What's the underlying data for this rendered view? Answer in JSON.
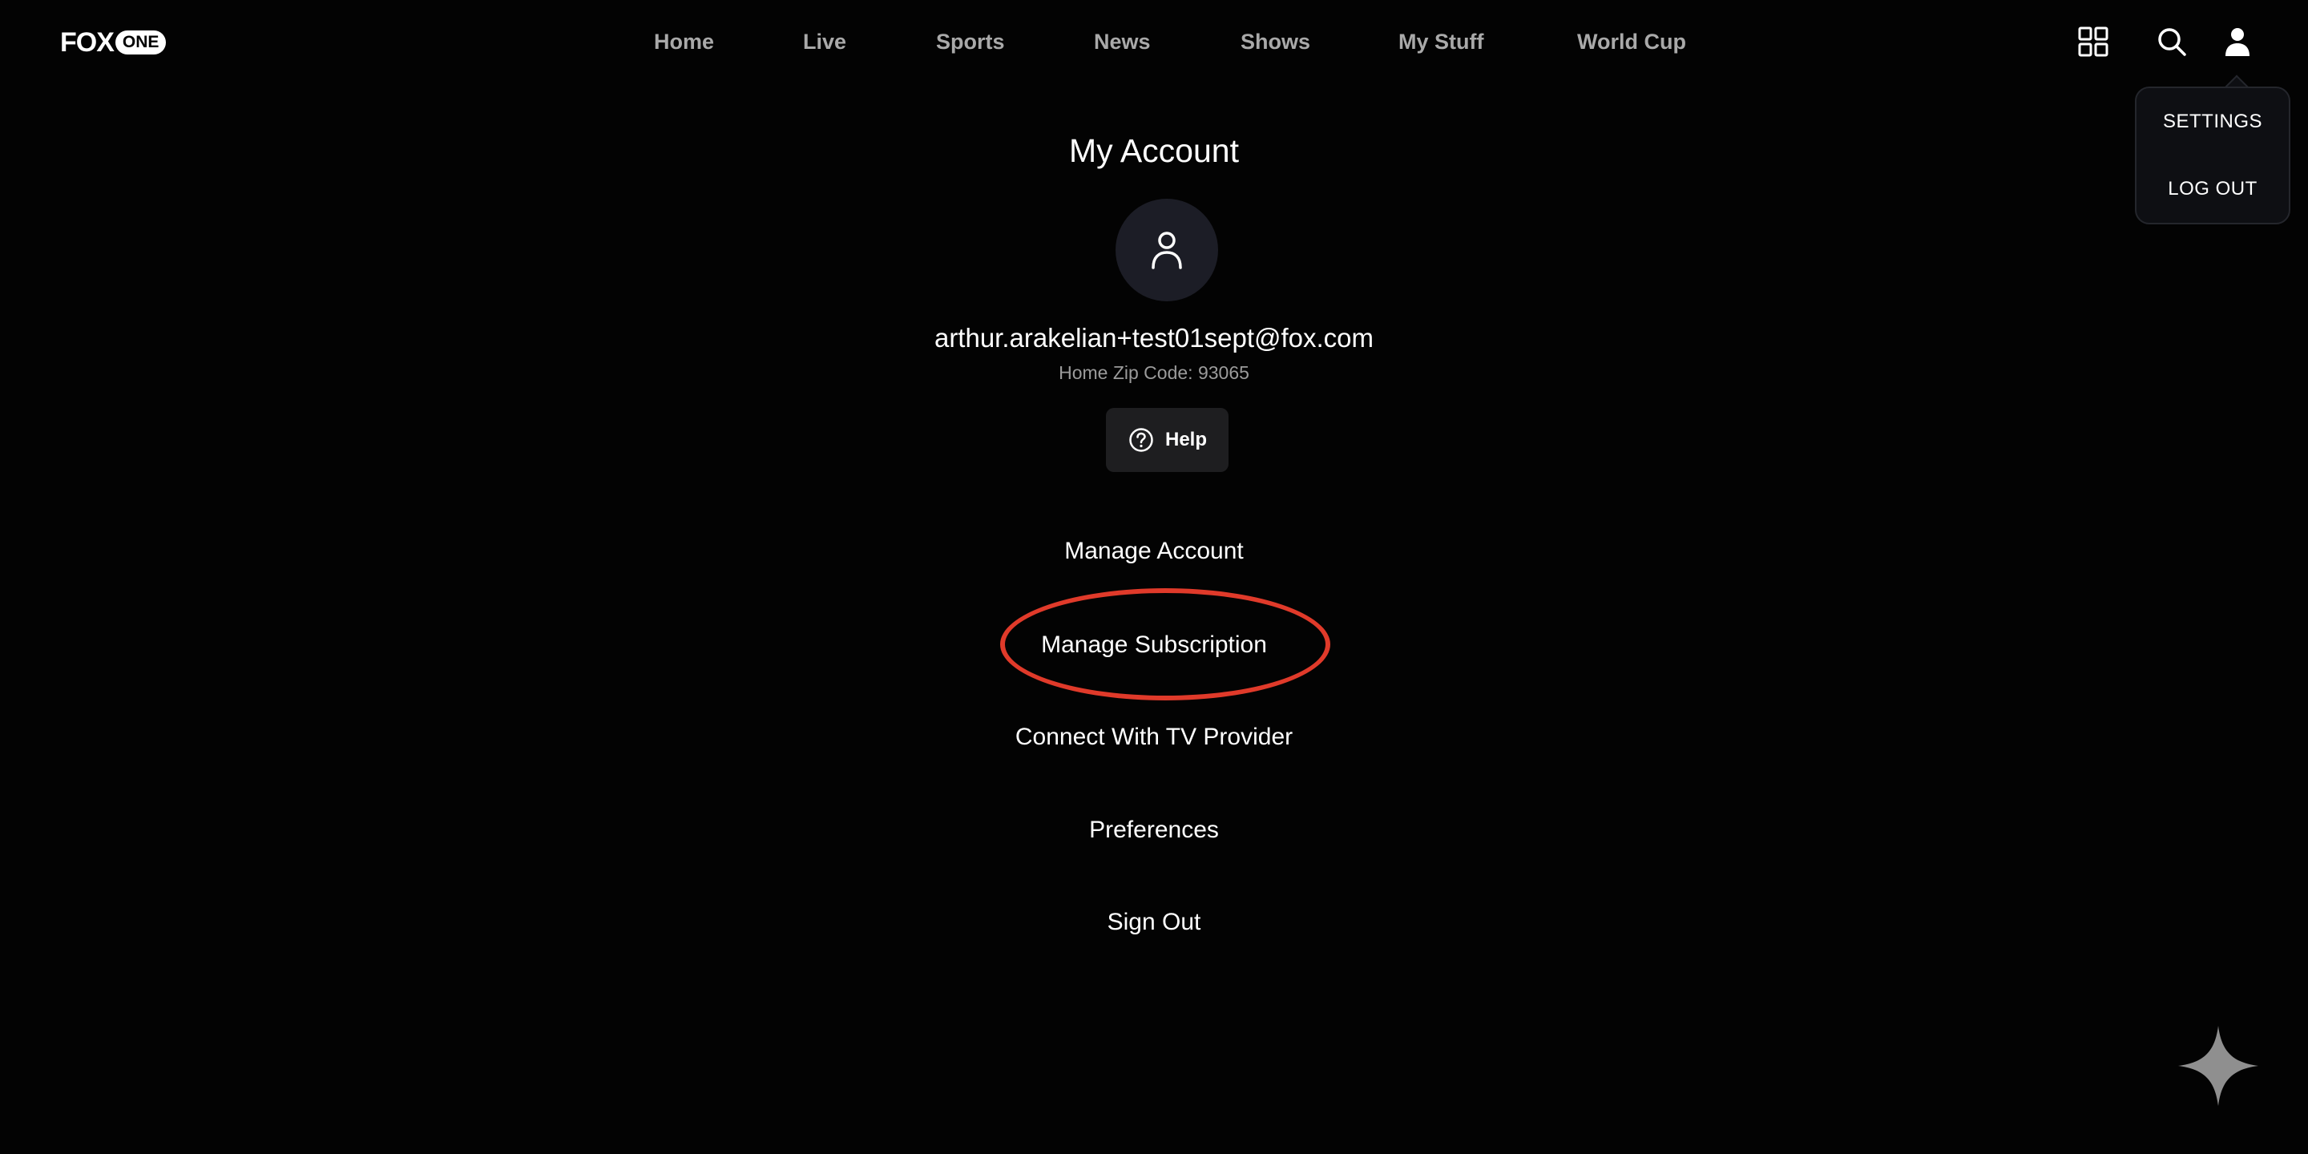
{
  "brand": {
    "logo_fox": "FOX",
    "logo_one": "ONE"
  },
  "nav": {
    "items": [
      "Home",
      "Live",
      "Sports",
      "News",
      "Shows",
      "My Stuff",
      "World Cup"
    ]
  },
  "header_icons": [
    "grid-icon",
    "search-icon",
    "user-icon"
  ],
  "profile_menu": {
    "items": [
      "SETTINGS",
      "LOG OUT"
    ]
  },
  "account": {
    "title": "My Account",
    "email": "arthur.arakelian+test01sept@fox.com",
    "zip": "Home Zip Code: 93065",
    "help_label": "Help",
    "links": [
      "Manage Account",
      "Manage Subscription",
      "Connect With TV Provider",
      "Preferences",
      "Sign Out"
    ]
  },
  "annotation": {
    "highlighted_item": "Manage Subscription",
    "color": "#e03a2a"
  },
  "colors": {
    "background": "#030303",
    "nav_text": "#a9a9a9",
    "avatar_bg": "#1c1d26",
    "help_bg": "#1e1e20",
    "dropdown_bg": "#0e0f13"
  }
}
